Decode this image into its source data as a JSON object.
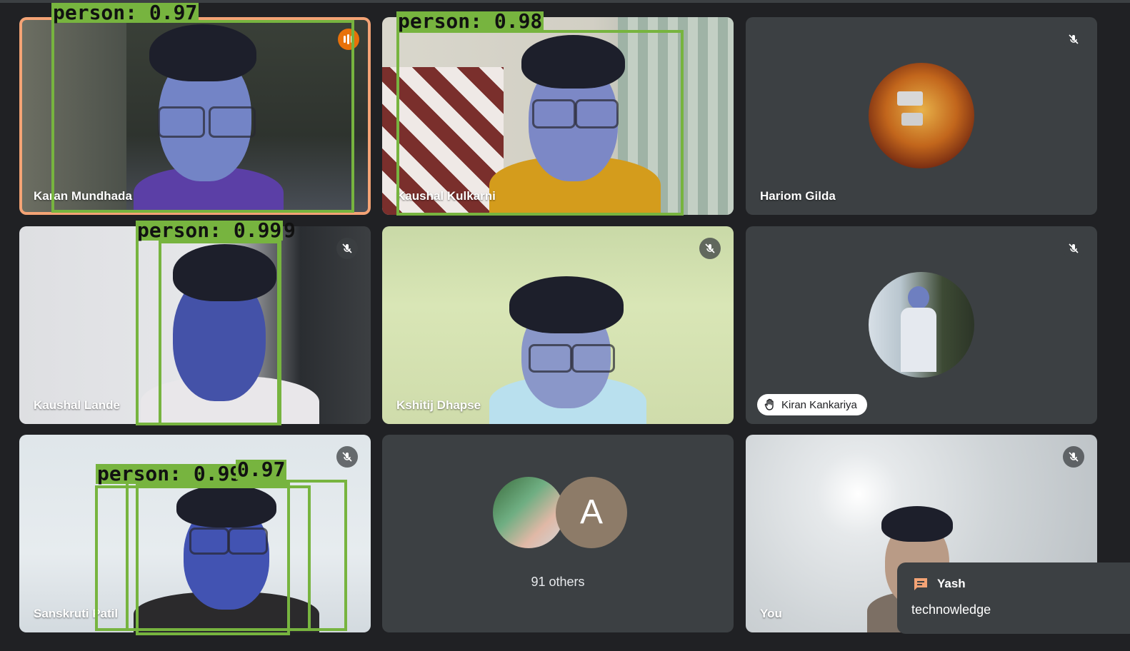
{
  "tiles": [
    {
      "name": "Karan Mundhada",
      "muted": false,
      "speaking": true
    },
    {
      "name": "Kaushal Kulkarni",
      "muted": false
    },
    {
      "name": "Hariom Gilda",
      "muted": true
    },
    {
      "name": "Kaushal Lande",
      "muted": true
    },
    {
      "name": "Kshitij Dhapse",
      "muted": true
    },
    {
      "name": "Kiran Kankariya",
      "muted": true,
      "hand_raised": true
    },
    {
      "name": "Sanskruti Patil",
      "muted": true
    },
    {
      "others_label": "91 others",
      "avatar_letter": "A"
    },
    {
      "name": "You",
      "muted": true
    }
  ],
  "detections": [
    {
      "label": "person:  0.97"
    },
    {
      "label": "person:  0.98"
    },
    {
      "label": "person:  0.99"
    },
    {
      "label": "9"
    },
    {
      "label": "person:  0.99"
    },
    {
      "label": "0.97"
    }
  ],
  "chat_notification": {
    "sender": "Yash",
    "message": "technowledge"
  },
  "colors": {
    "detection": "#77b43f",
    "tile_bg": "#3c4043",
    "speaking": "#e8710a",
    "active_border": "#f4a375"
  }
}
